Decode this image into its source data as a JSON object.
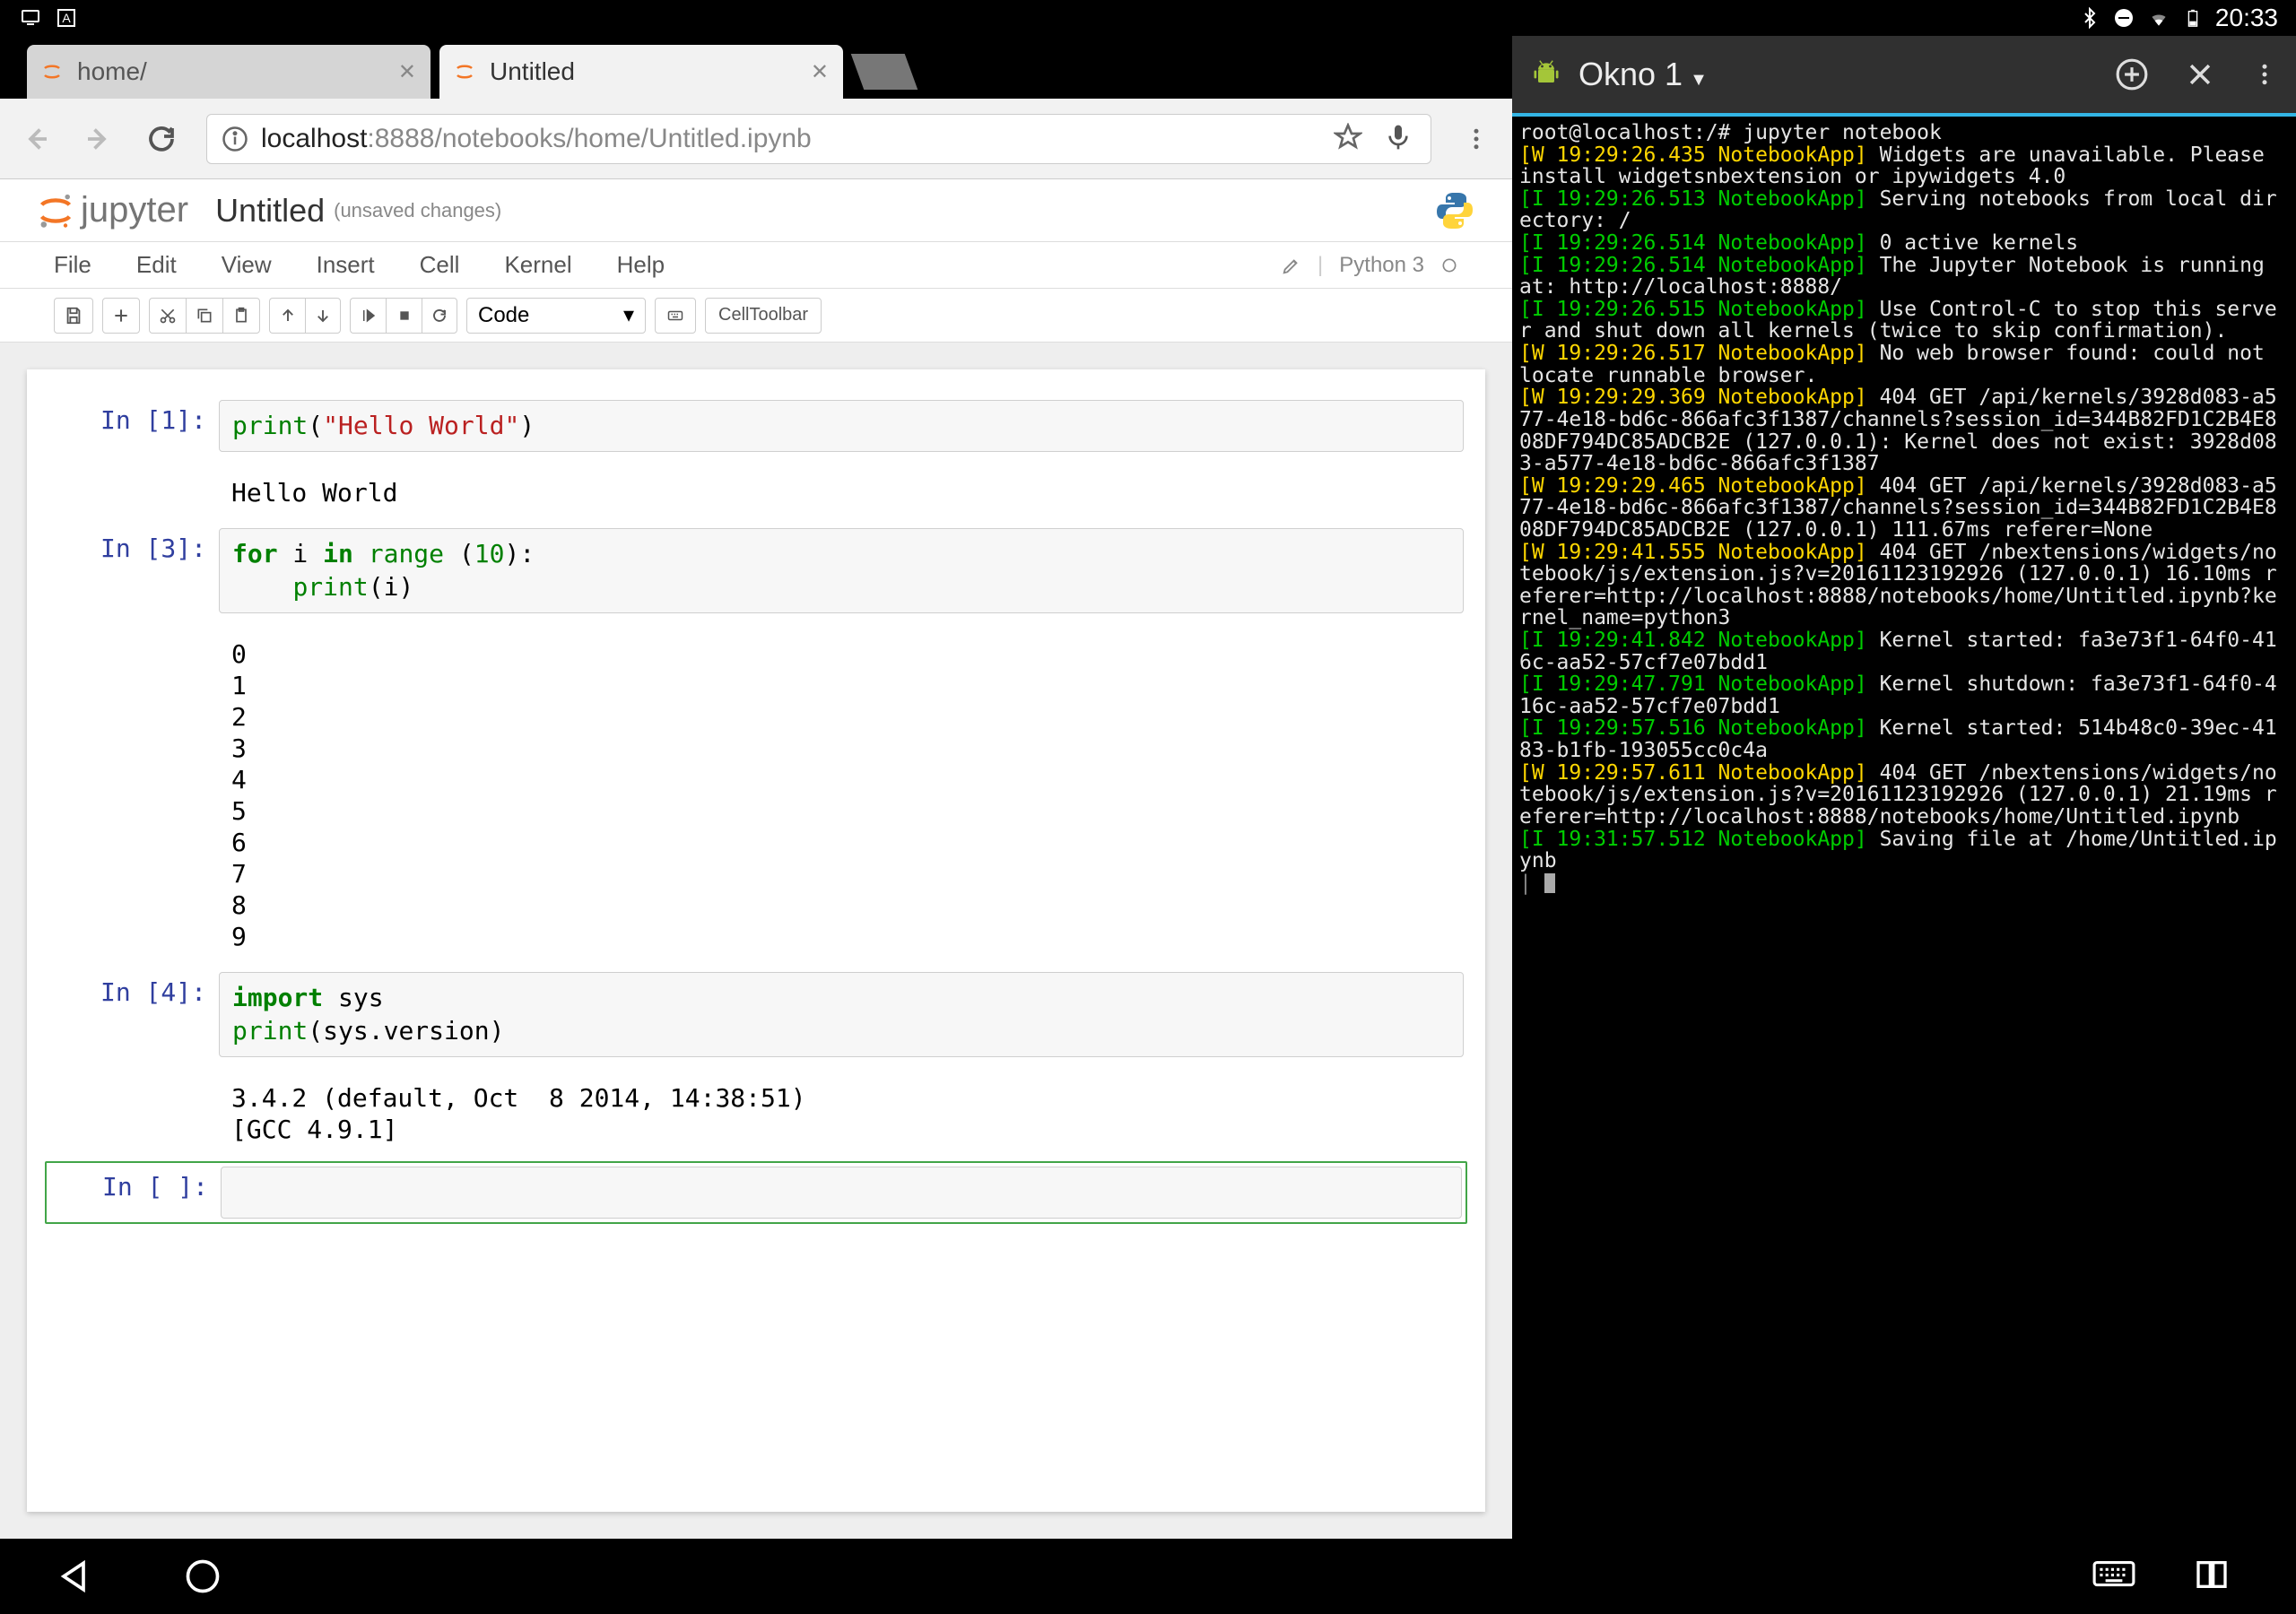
{
  "status_bar": {
    "time": "20:33"
  },
  "browser": {
    "tabs": [
      {
        "title": "home/",
        "active": false
      },
      {
        "title": "Untitled",
        "active": true
      }
    ],
    "url_host": "localhost",
    "url_path": ":8888/notebooks/home/Untitled.ipynb"
  },
  "jupyter": {
    "logo": "jupyter",
    "title": "Untitled",
    "unsaved": "(unsaved changes)",
    "menubar": [
      "File",
      "Edit",
      "View",
      "Insert",
      "Cell",
      "Kernel",
      "Help"
    ],
    "kernel_label": "Python 3",
    "cell_type": "Code",
    "cell_toolbar": "CellToolbar",
    "cells": [
      {
        "prompt": "In [1]:",
        "code_html": "<span class='builtin'>print</span>(<span class='str'>\"Hello World\"</span>)",
        "output": "Hello World"
      },
      {
        "prompt": "In [3]:",
        "code_html": "<span class='kw'>for</span> i <span class='kw'>in</span> <span class='builtin'>range</span> (<span class='num'>10</span>):\n    <span class='builtin'>print</span>(i)",
        "output": "0\n1\n2\n3\n4\n5\n6\n7\n8\n9"
      },
      {
        "prompt": "In [4]:",
        "code_html": "<span class='kw'>import</span> sys\n<span class='builtin'>print</span>(sys.version)",
        "output": "3.4.2 (default, Oct  8 2014, 14:38:51) \n[GCC 4.9.1]"
      },
      {
        "prompt": "In [ ]:",
        "code_html": "",
        "output": null,
        "selected": true
      }
    ]
  },
  "terminal": {
    "title": "Okno 1",
    "lines": [
      {
        "parts": [
          {
            "c": "w",
            "t": "root@localhost:/# jupyter notebook"
          }
        ]
      },
      {
        "parts": [
          {
            "c": "y",
            "t": "[W 19:29:26.435 NotebookApp]"
          },
          {
            "c": "w",
            "t": " Widgets are unavailable. Please install widgetsnbextension or ipywidgets 4.0"
          }
        ]
      },
      {
        "parts": [
          {
            "c": "g",
            "t": "[I 19:29:26.513 NotebookApp]"
          },
          {
            "c": "w",
            "t": " Serving notebooks from local directory: /"
          }
        ]
      },
      {
        "parts": [
          {
            "c": "g",
            "t": "[I 19:29:26.514 NotebookApp]"
          },
          {
            "c": "w",
            "t": " 0 active kernels "
          }
        ]
      },
      {
        "parts": [
          {
            "c": "g",
            "t": "[I 19:29:26.514 NotebookApp]"
          },
          {
            "c": "w",
            "t": " The Jupyter Notebook is running at: http://localhost:8888/"
          }
        ]
      },
      {
        "parts": [
          {
            "c": "g",
            "t": "[I 19:29:26.515 NotebookApp]"
          },
          {
            "c": "w",
            "t": " Use Control-C to stop this server and shut down all kernels (twice to skip confirmation)."
          }
        ]
      },
      {
        "parts": [
          {
            "c": "y",
            "t": "[W 19:29:26.517 NotebookApp]"
          },
          {
            "c": "w",
            "t": " No web browser found: could not locate runnable browser."
          }
        ]
      },
      {
        "parts": [
          {
            "c": "y",
            "t": "[W 19:29:29.369 NotebookApp]"
          },
          {
            "c": "w",
            "t": " 404 GET /api/kernels/3928d083-a577-4e18-bd6c-866afc3f1387/channels?session_id=344B82FD1C2B4E808DF794DC85ADCB2E (127.0.0.1): Kernel does not exist: 3928d083-a577-4e18-bd6c-866afc3f1387"
          }
        ]
      },
      {
        "parts": [
          {
            "c": "y",
            "t": "[W 19:29:29.465 NotebookApp]"
          },
          {
            "c": "w",
            "t": " 404 GET /api/kernels/3928d083-a577-4e18-bd6c-866afc3f1387/channels?session_id=344B82FD1C2B4E808DF794DC85ADCB2E (127.0.0.1) 111.67ms referer=None"
          }
        ]
      },
      {
        "parts": [
          {
            "c": "y",
            "t": "[W 19:29:41.555 NotebookApp]"
          },
          {
            "c": "w",
            "t": " 404 GET /nbextensions/widgets/notebook/js/extension.js?v=20161123192926 (127.0.0.1) 16.10ms referer=http://localhost:8888/notebooks/home/Untitled.ipynb?kernel_name=python3"
          }
        ]
      },
      {
        "parts": [
          {
            "c": "g",
            "t": "[I 19:29:41.842 NotebookApp]"
          },
          {
            "c": "w",
            "t": " Kernel started: fa3e73f1-64f0-416c-aa52-57cf7e07bdd1"
          }
        ]
      },
      {
        "parts": [
          {
            "c": "g",
            "t": "[I 19:29:47.791 NotebookApp]"
          },
          {
            "c": "w",
            "t": " Kernel shutdown: fa3e73f1-64f0-416c-aa52-57cf7e07bdd1"
          }
        ]
      },
      {
        "parts": [
          {
            "c": "g",
            "t": "[I 19:29:57.516 NotebookApp]"
          },
          {
            "c": "w",
            "t": " Kernel started: 514b48c0-39ec-4183-b1fb-193055cc0c4a"
          }
        ]
      },
      {
        "parts": [
          {
            "c": "y",
            "t": "[W 19:29:57.611 NotebookApp]"
          },
          {
            "c": "w",
            "t": " 404 GET /nbextensions/widgets/notebook/js/extension.js?v=20161123192926 (127.0.0.1) 21.19ms referer=http://localhost:8888/notebooks/home/Untitled.ipynb"
          }
        ]
      },
      {
        "parts": [
          {
            "c": "g",
            "t": "[I 19:31:57.512 NotebookApp]"
          },
          {
            "c": "w",
            "t": " Saving file at /home/Untitled.ipynb"
          }
        ]
      }
    ]
  }
}
